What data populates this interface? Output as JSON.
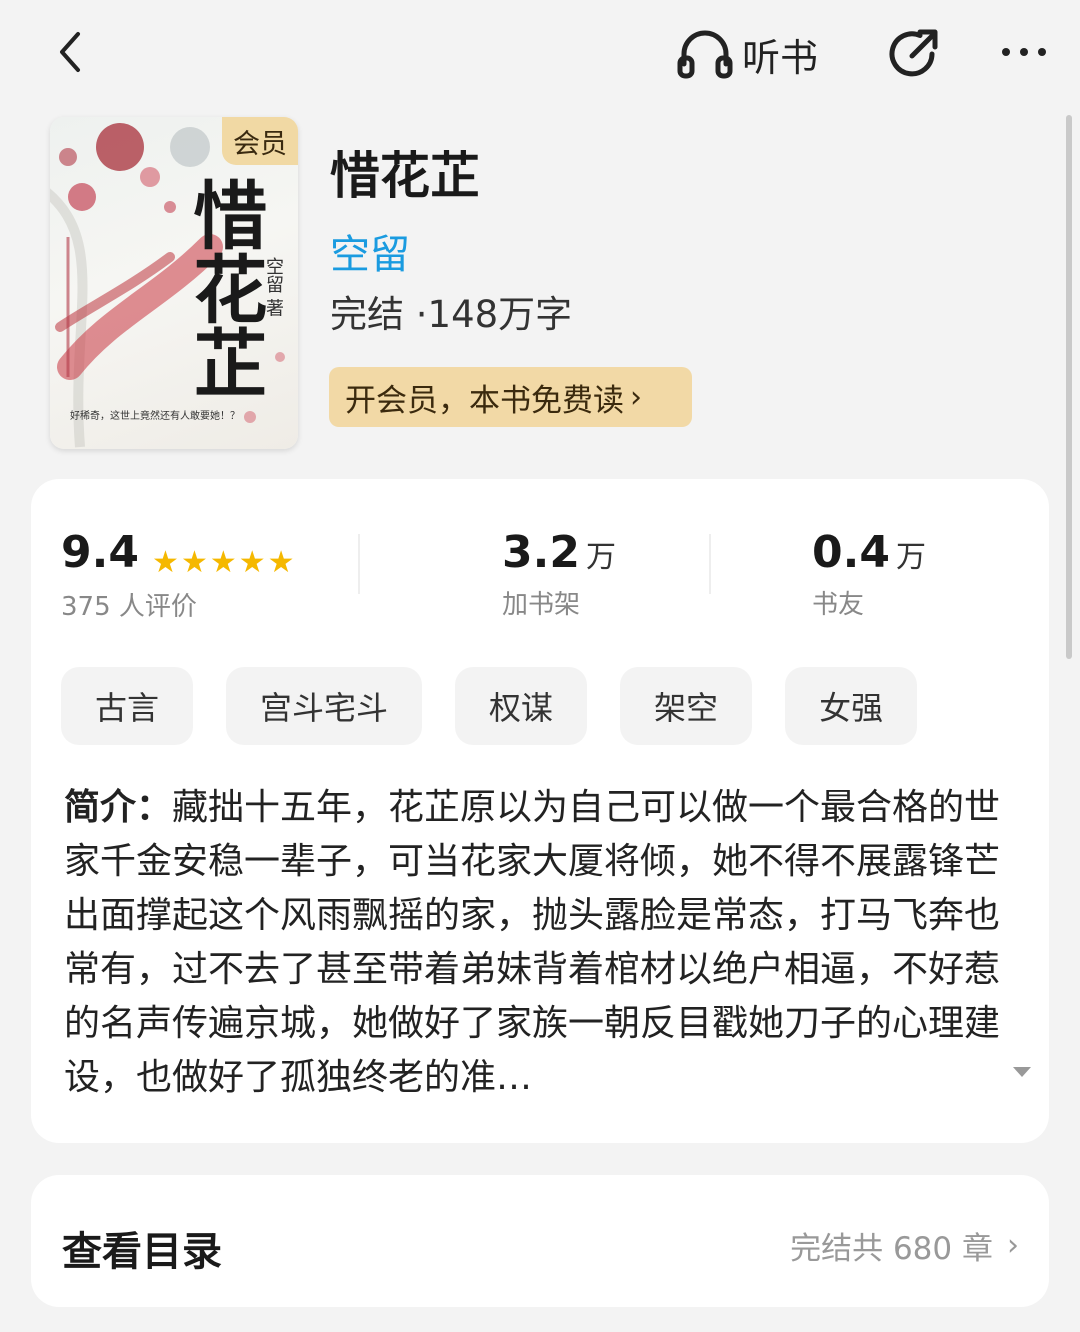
{
  "header": {
    "listen_label": "听书"
  },
  "book": {
    "badge": "会员",
    "cover_title": "惜花芷",
    "cover_author": "空留 著",
    "cover_blurb": "好稀奇，这世上竟然还有人敢要她！？",
    "title": "惜花芷",
    "author": "空留",
    "status": "完结 ·148万字",
    "vip_button": "开会员，本书免费读"
  },
  "stats": {
    "rating": {
      "value": "9.4",
      "label": "375 人评价",
      "stars": 5
    },
    "shelf": {
      "value": "3.2",
      "unit": "万",
      "label": "加书架"
    },
    "friends": {
      "value": "0.4",
      "unit": "万",
      "label": "书友"
    }
  },
  "tags": [
    "古言",
    "宫斗宅斗",
    "权谋",
    "架空",
    "女强"
  ],
  "intro": {
    "label": "简介：",
    "text": "藏拙十五年，花芷原以为自己可以做一个最合格的世家千金安稳一辈子，可当花家大厦将倾，她不得不展露锋芒出面撑起这个风雨飘摇的家，抛头露脸是常态，打马飞奔也常有，过不去了甚至带着弟妹背着棺材以绝户相逼，不好惹的名声传遍京城，她做好了家族一朝反目戳她刀子的心理建设，也做好了孤独终老的准…"
  },
  "toc": {
    "title": "查看目录",
    "meta": "完结共 680 章"
  },
  "colors": {
    "author": "#1a9be0",
    "vip_gold": "#f2d9a6",
    "star": "#f5b800"
  }
}
